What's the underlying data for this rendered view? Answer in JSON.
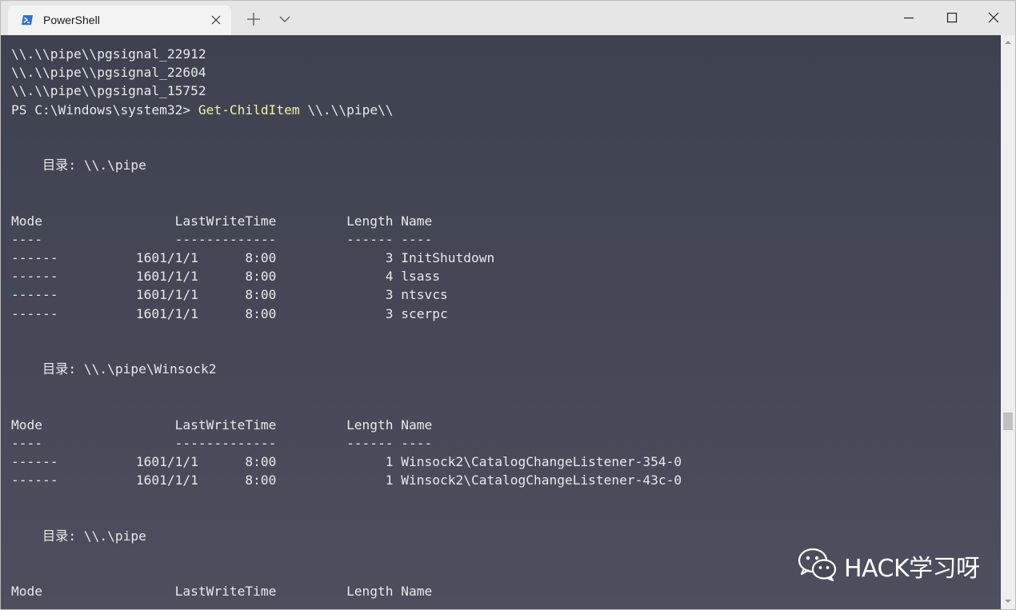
{
  "titlebar": {
    "tab_title": "PowerShell",
    "icons": [
      "powershell-icon",
      "close-icon",
      "plus-icon",
      "chevron-down-icon",
      "minimize-icon",
      "maximize-icon",
      "close-window-icon"
    ]
  },
  "terminal": {
    "lines": [
      {
        "text": "\\\\.\\\\pipe\\\\pgsignal_22912"
      },
      {
        "text": "\\\\.\\\\pipe\\\\pgsignal_22604"
      },
      {
        "text": "\\\\.\\\\pipe\\\\pgsignal_15752"
      },
      {
        "prompt": "PS C:\\Windows\\system32> ",
        "cmd": "Get-ChildItem",
        "args": " \\\\.\\\\pipe\\\\"
      },
      {
        "text": ""
      },
      {
        "text": ""
      },
      {
        "text": "    目录: \\\\.\\pipe"
      },
      {
        "text": ""
      },
      {
        "text": ""
      },
      {
        "text": "Mode                 LastWriteTime         Length Name"
      },
      {
        "text": "----                 -------------         ------ ----"
      },
      {
        "text": "------          1601/1/1      8:00              3 InitShutdown"
      },
      {
        "text": "------          1601/1/1      8:00              4 lsass"
      },
      {
        "text": "------          1601/1/1      8:00              3 ntsvcs"
      },
      {
        "text": "------          1601/1/1      8:00              3 scerpc"
      },
      {
        "text": ""
      },
      {
        "text": ""
      },
      {
        "text": "    目录: \\\\.\\pipe\\Winsock2"
      },
      {
        "text": ""
      },
      {
        "text": ""
      },
      {
        "text": "Mode                 LastWriteTime         Length Name"
      },
      {
        "text": "----                 -------------         ------ ----"
      },
      {
        "text": "------          1601/1/1      8:00              1 Winsock2\\CatalogChangeListener-354-0"
      },
      {
        "text": "------          1601/1/1      8:00              1 Winsock2\\CatalogChangeListener-43c-0"
      },
      {
        "text": ""
      },
      {
        "text": ""
      },
      {
        "text": "    目录: \\\\.\\pipe"
      },
      {
        "text": ""
      },
      {
        "text": ""
      },
      {
        "text": "Mode                 LastWriteTime         Length Name"
      }
    ],
    "colors": {
      "background": "#464858",
      "foreground": "#e8e8e8",
      "command": "#f2f2a0"
    }
  },
  "watermark": {
    "text": "HACK学习呀",
    "icon": "wechat-icon"
  }
}
